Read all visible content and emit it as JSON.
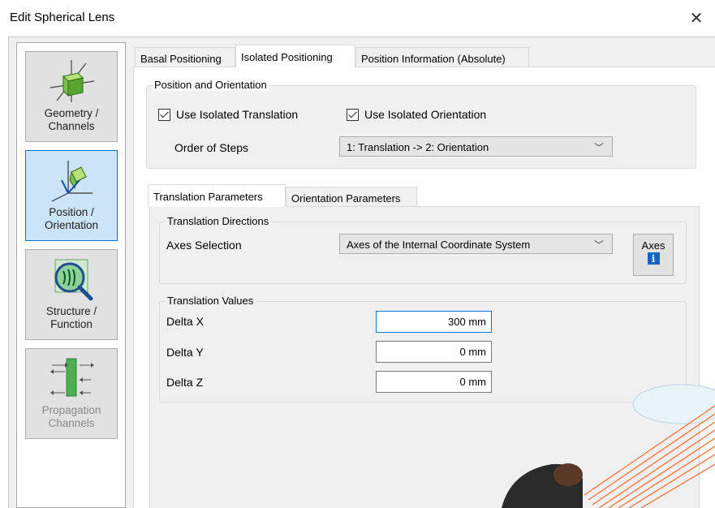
{
  "window": {
    "title": "Edit Spherical Lens"
  },
  "sidebar": {
    "items": [
      {
        "label": "Geometry /\nChannels"
      },
      {
        "label": "Position /\nOrientation"
      },
      {
        "label": "Structure /\nFunction"
      },
      {
        "label": "Propagation\nChannels"
      }
    ]
  },
  "tabs": [
    {
      "label": "Basal Positioning"
    },
    {
      "label": "Isolated Positioning"
    },
    {
      "label": "Position Information (Absolute)"
    }
  ],
  "position_orientation": {
    "legend": "Position and Orientation",
    "use_isolated_translation": "Use Isolated Translation",
    "use_isolated_orientation": "Use Isolated Orientation",
    "order_label": "Order of Steps",
    "order_value": "1: Translation -> 2: Orientation"
  },
  "subtabs": [
    {
      "label": "Translation Parameters"
    },
    {
      "label": "Orientation Parameters"
    }
  ],
  "translation_directions": {
    "legend": "Translation Directions",
    "axes_label": "Axes Selection",
    "axes_value": "Axes of the Internal Coordinate System",
    "axes_button": "Axes"
  },
  "translation_values": {
    "legend": "Translation Values",
    "rows": [
      {
        "label": "Delta X",
        "value": "300 mm"
      },
      {
        "label": "Delta Y",
        "value": "0 mm"
      },
      {
        "label": "Delta Z",
        "value": "0 mm"
      }
    ]
  },
  "colors": {
    "accent": "#0078d7",
    "active_sidebar": "#cce4f7",
    "beam": "#ff5a1f"
  }
}
